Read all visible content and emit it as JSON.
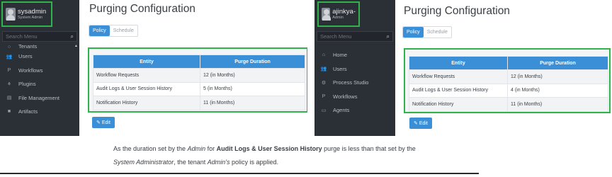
{
  "left": {
    "user": {
      "name": "sysadmin",
      "role": "System Admin"
    },
    "search_placeholder": "Search Menu",
    "menu_partial": "Tenants",
    "menu": [
      {
        "label": "Users",
        "icon": "users-icon",
        "glyph": "👥"
      },
      {
        "label": "Workflows",
        "icon": "workflow-icon",
        "glyph": "P"
      },
      {
        "label": "Plugins",
        "icon": "plug-icon",
        "glyph": "⚘"
      },
      {
        "label": "File Management",
        "icon": "file-icon",
        "glyph": "▤"
      },
      {
        "label": "Artifacts",
        "icon": "artifacts-icon",
        "glyph": "■"
      }
    ],
    "title": "Purging Configuration",
    "tabs": [
      "Policy",
      "Schedule"
    ],
    "table": {
      "headers": [
        "Entity",
        "Purge Duration"
      ],
      "rows": [
        [
          "Workflow Requests",
          "12 (in Months)"
        ],
        [
          "Audit Logs & User Session History",
          "5 (in Months)"
        ],
        [
          "Notification History",
          "11 (in Months)"
        ]
      ]
    },
    "edit_label": "Edit"
  },
  "right": {
    "user": {
      "name": "ajinkya-",
      "role": "Admin"
    },
    "search_placeholder": "Search Menu",
    "menu": [
      {
        "label": "Home",
        "icon": "home-icon",
        "glyph": "⌂"
      },
      {
        "label": "Users",
        "icon": "users-icon",
        "glyph": "👥"
      },
      {
        "label": "Process Studio",
        "icon": "gears-icon",
        "glyph": "⚙"
      },
      {
        "label": "Workflows",
        "icon": "workflow-icon",
        "glyph": "P"
      },
      {
        "label": "Agents",
        "icon": "monitor-icon",
        "glyph": "▭"
      }
    ],
    "title": "Purging Configuration",
    "tabs": [
      "Policy",
      "Schedule"
    ],
    "table": {
      "headers": [
        "Entity",
        "Purge Duration"
      ],
      "rows": [
        [
          "Workflow Requests",
          "12 (in Months)"
        ],
        [
          "Audit Logs & User Session History",
          "4 (in Months)"
        ],
        [
          "Notification History",
          "11 (in Months)"
        ]
      ]
    },
    "edit_label": "Edit"
  },
  "caption": {
    "line1_pre": "As the duration set by the ",
    "line1_admin": "Admin",
    "line1_mid": " for ",
    "line1_bold": "Audit Logs & User Session History",
    "line1_post": " purge is less than that set by the",
    "line2_sysadmin": "System Administrator",
    "line2_mid": ", the tenant ",
    "line2_admin": "Admin's",
    "line2_post": " policy is applied."
  }
}
